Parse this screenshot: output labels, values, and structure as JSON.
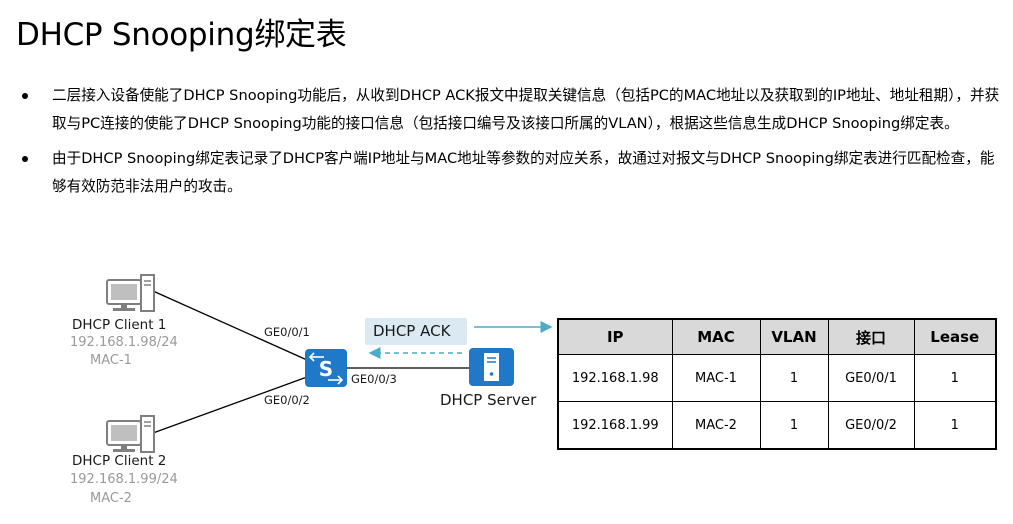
{
  "title": "DHCP Snooping绑定表",
  "bullets": [
    "二层接入设备使能了DHCP Snooping功能后，从收到DHCP ACK报文中提取关键信息（包括PC的MAC地址以及获取到的IP地址、地址租期），并获取与PC连接的使能了DHCP Snooping功能的接口信息（包括接口编号及该接口所属的VLAN），根据这些信息生成DHCP Snooping绑定表。",
    "由于DHCP Snooping绑定表记录了DHCP客户端IP地址与MAC地址等参数的对应关系，故通过对报文与DHCP Snooping绑定表进行匹配检查，能够有效防范非法用户的攻击。"
  ],
  "diagram": {
    "client1": {
      "name": "DHCP Client 1",
      "ip": "192.168.1.98/24",
      "mac": "MAC-1"
    },
    "client2": {
      "name": "DHCP Client 2",
      "ip": "192.168.1.99/24",
      "mac": "MAC-2"
    },
    "switch_label": "S",
    "ports": {
      "p1": "GE0/0/1",
      "p2": "GE0/0/2",
      "p3": "GE0/0/3"
    },
    "ack_label": "DHCP ACK",
    "server_name": "DHCP Server",
    "colors": {
      "switch": "#1f78c8",
      "server": "#1f78c8",
      "pc": "#7f7f7f",
      "arrow": "#4bacc6",
      "ack_box": "#dbe9f3",
      "table_header": "#d9d9d9"
    }
  },
  "binding_table": {
    "headers": [
      "IP",
      "MAC",
      "VLAN",
      "接口",
      "Lease"
    ],
    "rows": [
      [
        "192.168.1.98",
        "MAC-1",
        "1",
        "GE0/0/1",
        "1"
      ],
      [
        "192.168.1.99",
        "MAC-2",
        "1",
        "GE0/0/2",
        "1"
      ]
    ]
  }
}
